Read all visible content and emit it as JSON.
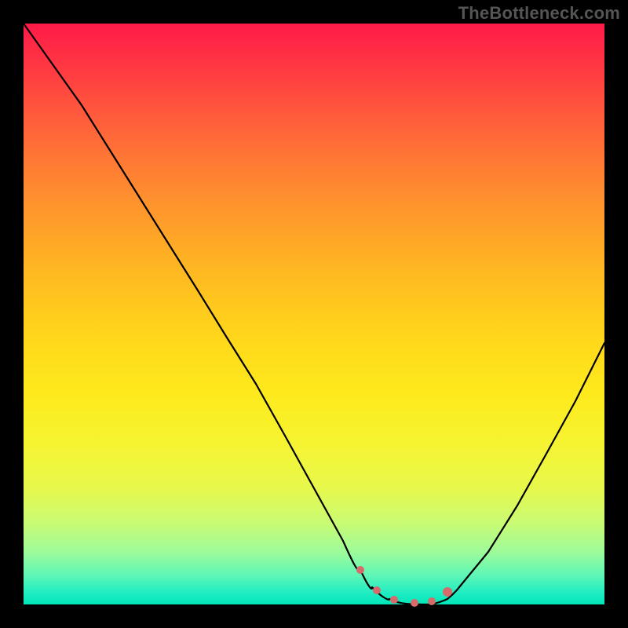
{
  "watermark": {
    "text": "TheBottleneck.com"
  },
  "chart_data": {
    "type": "line",
    "title": "",
    "xlabel": "",
    "ylabel": "",
    "xlim": [
      0,
      100
    ],
    "ylim": [
      0,
      100
    ],
    "grid": false,
    "legend": false,
    "background_gradient": [
      "#ff1a48",
      "#ffdb1a",
      "#00e6b8"
    ],
    "series": [
      {
        "name": "bottleneck-curve",
        "x": [
          0,
          5,
          10,
          15,
          20,
          25,
          30,
          35,
          40,
          45,
          50,
          55,
          58,
          60,
          63,
          66,
          70,
          73,
          75,
          80,
          85,
          90,
          95,
          100
        ],
        "y": [
          100,
          93,
          86,
          78,
          70,
          62,
          54,
          46,
          38,
          29,
          20,
          11,
          6,
          3,
          1,
          0,
          0,
          1,
          3,
          9,
          17,
          26,
          35,
          45
        ]
      }
    ],
    "markers": [
      {
        "name": "flat-range-start",
        "x": 58,
        "y": 6
      },
      {
        "name": "flat-range-end",
        "x": 73,
        "y": 1
      }
    ],
    "annotations": []
  }
}
